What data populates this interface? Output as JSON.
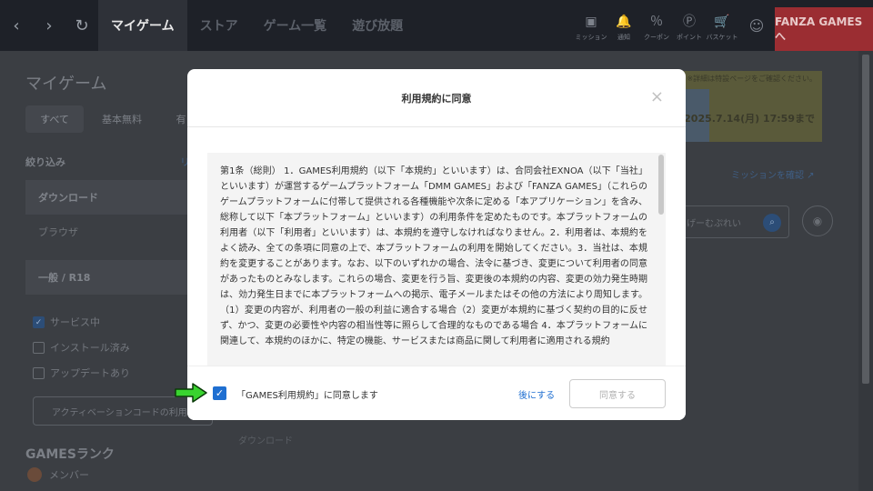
{
  "nav": {
    "back": "‹",
    "forward": "›",
    "reload": "↻",
    "tabs": [
      "マイゲーム",
      "ストア",
      "ゲーム一覧",
      "遊び放題"
    ],
    "icons": [
      {
        "name": "mission-icon",
        "glyph": "▣",
        "label": "ミッション"
      },
      {
        "name": "bell-icon",
        "glyph": "🔔",
        "label": "通知"
      },
      {
        "name": "coupon-icon",
        "glyph": "％",
        "label": "クーポン"
      },
      {
        "name": "points-icon",
        "glyph": "Ⓟ",
        "label": "ポイント"
      },
      {
        "name": "cart-icon",
        "glyph": "🛒",
        "label": "バスケット"
      }
    ],
    "profile_glyph": "☺",
    "fanza": "FANZA GAMESへ"
  },
  "page": {
    "title": "マイゲーム",
    "tabs": [
      "すべて",
      "基本無料",
      "有"
    ],
    "filter_label": "絞り込み",
    "filter_link": "リ",
    "sidebar": [
      "ダウンロード",
      "ブラウザ",
      "一般 / R18"
    ],
    "checks": [
      {
        "label": "サービス中",
        "checked": true
      },
      {
        "label": "インストール済み",
        "checked": false
      },
      {
        "label": "アップデートあり",
        "checked": false
      }
    ],
    "activation": "アクティベーションコードの利用",
    "rank_title": "GAMESランク",
    "member": "メンバー",
    "banner_note": "※詳細は特設ページをご確認ください。",
    "banner_date": "2025.7.14(月) 17:59まで",
    "mission_link": "ミッションを確認 ↗",
    "search_text": "げーむぷれい",
    "bg_game_name": "ダウンロード"
  },
  "modal": {
    "title": "利用規約に同意",
    "close": "×",
    "terms": "第1条（総則） 1．GAMES利用規約（以下「本規約」といいます）は、合同会社EXNOA（以下「当社」といいます）が運営するゲームプラットフォーム「DMM GAMES」および「FANZA GAMES」（これらのゲームプラットフォームに付帯して提供される各種機能や次条に定める「本アプリケーション」を含み、総称して以下「本プラットフォーム」といいます）の利用条件を定めたものです。本プラットフォームの利用者（以下「利用者」といいます）は、本規約を遵守しなければなりません。2．利用者は、本規約をよく読み、全ての条項に同意の上で、本プラットフォームの利用を開始してください。3．当社は、本規約を変更することがあります。なお、以下のいずれかの場合、法令に基づき、変更について利用者の同意があったものとみなします。これらの場合、変更を行う旨、変更後の本規約の内容、変更の効力発生時期は、効力発生日までに本プラットフォームへの掲示、電子メールまたはその他の方法により周知します。（1）変更の内容が、利用者の一般の利益に適合する場合（2）変更が本規約に基づく契約の目的に反せず、かつ、変更の必要性や内容の相当性等に照らして合理的なものである場合 4．本プラットフォームに関連して、本規約のほかに、特定の機能、サービスまたは商品に関して利用者に適用される規約",
    "agree_label": "「GAMES利用規約」に同意します",
    "agree_checked": true,
    "later": "後にする",
    "agree_button": "同意する"
  }
}
